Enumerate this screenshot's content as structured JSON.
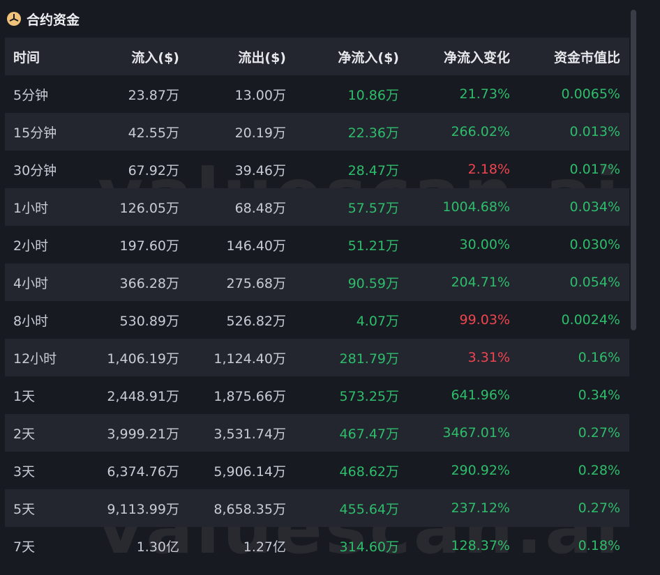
{
  "title": "合约资金",
  "watermark": "valuescan.ai",
  "columns": [
    "时间",
    "流入($)",
    "流出($)",
    "净流入($)",
    "净流入变化",
    "资金市值比"
  ],
  "rows": [
    {
      "time": "5分钟",
      "inflow": "23.87万",
      "outflow": "13.00万",
      "net": "10.86万",
      "change": "21.73%",
      "change_sign": "pos",
      "ratio": "0.0065%"
    },
    {
      "time": "15分钟",
      "inflow": "42.55万",
      "outflow": "20.19万",
      "net": "22.36万",
      "change": "266.02%",
      "change_sign": "pos",
      "ratio": "0.013%"
    },
    {
      "time": "30分钟",
      "inflow": "67.92万",
      "outflow": "39.46万",
      "net": "28.47万",
      "change": "2.18%",
      "change_sign": "neg",
      "ratio": "0.017%"
    },
    {
      "time": "1小时",
      "inflow": "126.05万",
      "outflow": "68.48万",
      "net": "57.57万",
      "change": "1004.68%",
      "change_sign": "pos",
      "ratio": "0.034%"
    },
    {
      "time": "2小时",
      "inflow": "197.60万",
      "outflow": "146.40万",
      "net": "51.21万",
      "change": "30.00%",
      "change_sign": "pos",
      "ratio": "0.030%"
    },
    {
      "time": "4小时",
      "inflow": "366.28万",
      "outflow": "275.68万",
      "net": "90.59万",
      "change": "204.71%",
      "change_sign": "pos",
      "ratio": "0.054%"
    },
    {
      "time": "8小时",
      "inflow": "530.89万",
      "outflow": "526.82万",
      "net": "4.07万",
      "change": "99.03%",
      "change_sign": "neg",
      "ratio": "0.0024%"
    },
    {
      "time": "12小时",
      "inflow": "1,406.19万",
      "outflow": "1,124.40万",
      "net": "281.79万",
      "change": "3.31%",
      "change_sign": "neg",
      "ratio": "0.16%"
    },
    {
      "time": "1天",
      "inflow": "2,448.91万",
      "outflow": "1,875.66万",
      "net": "573.25万",
      "change": "641.96%",
      "change_sign": "pos",
      "ratio": "0.34%"
    },
    {
      "time": "2天",
      "inflow": "3,999.21万",
      "outflow": "3,531.74万",
      "net": "467.47万",
      "change": "3467.01%",
      "change_sign": "pos",
      "ratio": "0.27%"
    },
    {
      "time": "3天",
      "inflow": "6,374.76万",
      "outflow": "5,906.14万",
      "net": "468.62万",
      "change": "290.92%",
      "change_sign": "pos",
      "ratio": "0.28%"
    },
    {
      "time": "5天",
      "inflow": "9,113.99万",
      "outflow": "8,658.35万",
      "net": "455.64万",
      "change": "237.12%",
      "change_sign": "pos",
      "ratio": "0.27%"
    },
    {
      "time": "7天",
      "inflow": "1.30亿",
      "outflow": "1.27亿",
      "net": "314.60万",
      "change": "128.37%",
      "change_sign": "pos",
      "ratio": "0.18%"
    }
  ],
  "colors": {
    "positive": "#2ebd6b",
    "negative": "#f0454f",
    "background": "#181a21",
    "row_alt": "#23262f"
  }
}
